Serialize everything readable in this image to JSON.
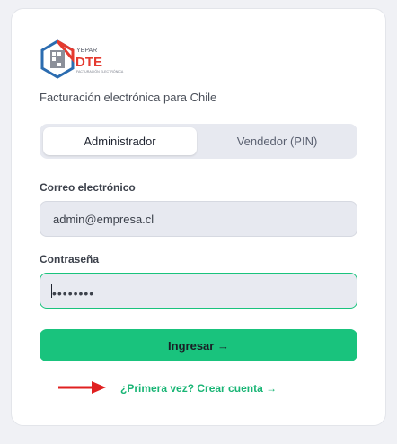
{
  "brand": {
    "logo_top_text": "YEPAR",
    "logo_main_text": "DTE",
    "logo_sub_text": "FACTURACIÓN ELECTRÓNICA",
    "tagline": "Facturación electrónica para Chile"
  },
  "login_mode": {
    "tabs": [
      {
        "label": "Administrador",
        "active": true
      },
      {
        "label": "Vendedor (PIN)",
        "active": false
      }
    ]
  },
  "form": {
    "email_label": "Correo electrónico",
    "email_value": "admin@empresa.cl",
    "password_label": "Contraseña",
    "password_mask": "••••••••",
    "submit_label": "Ingresar →"
  },
  "signup_link": "¿Primera vez? Crear cuenta →",
  "colors": {
    "accent": "#19c37d",
    "link": "#19b575",
    "annotation_arrow": "#e02020",
    "logo_red": "#e53a2f",
    "logo_blue": "#2b6cb0"
  }
}
